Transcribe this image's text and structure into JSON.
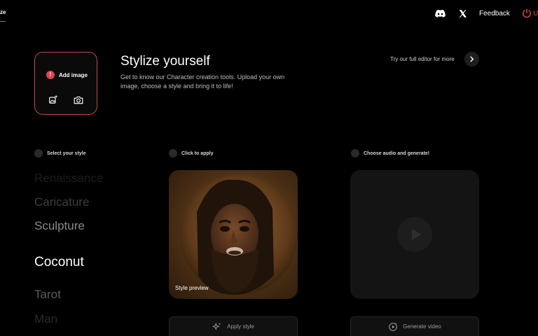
{
  "topbar": {
    "logo_fragment": "ze",
    "feedback": "Feedback",
    "user_fragment": "U"
  },
  "upload": {
    "warning_glyph": "!",
    "add_image": "Add image"
  },
  "hero": {
    "title": "Stylize yourself",
    "description": "Get to know our Character creation tools. Upload your own image, choose a style and bring it to life!",
    "try_editor": "Try our full editor for more"
  },
  "steps": [
    {
      "label": "Select your style"
    },
    {
      "label": "Click to apply"
    },
    {
      "label": "Choose audio and generate!"
    }
  ],
  "styles": [
    {
      "label": "Renaissance"
    },
    {
      "label": "Caricature"
    },
    {
      "label": "Sculpture"
    },
    {
      "label": "Coconut"
    },
    {
      "label": "Tarot"
    },
    {
      "label": "Man"
    }
  ],
  "preview": {
    "caption": "Style preview"
  },
  "buttons": {
    "apply_style": "Apply style",
    "generate_video": "Generate video"
  },
  "colors": {
    "accent": "#e0454f",
    "background": "#000000",
    "panel": "#141414"
  },
  "icons": {
    "discord": "discord-icon",
    "x": "x-logo-icon",
    "user": "user-power-icon",
    "add_image_ai": "image-sparkle-icon",
    "camera": "camera-icon",
    "chevron": "chevron-right-icon",
    "sparkle": "sparkle-icon",
    "play": "play-icon",
    "generate": "video-generate-icon"
  }
}
